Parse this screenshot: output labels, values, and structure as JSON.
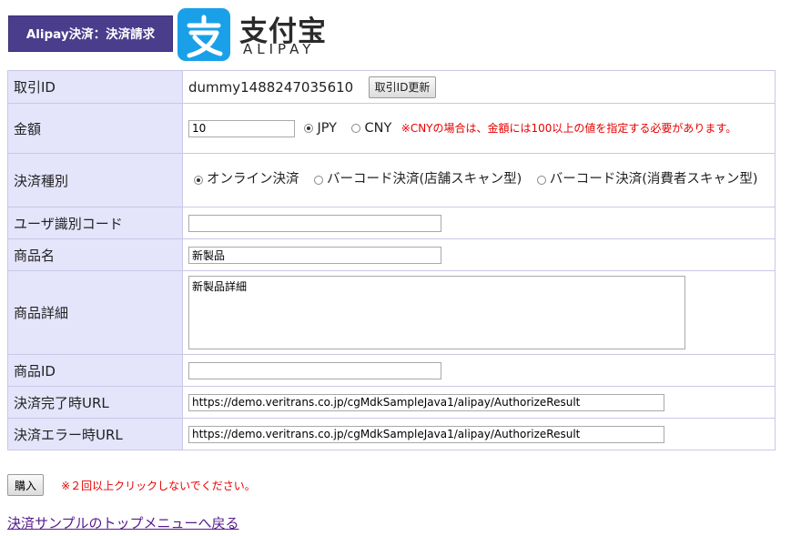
{
  "header": {
    "title": "Alipay決済：決済請求",
    "logo_cn": "支付宝",
    "logo_en": "ALIPAY"
  },
  "form": {
    "rows": [
      {
        "label": "取引ID"
      },
      {
        "label": "金額"
      },
      {
        "label": "決済種別"
      },
      {
        "label": "ユーザ識別コード"
      },
      {
        "label": "商品名"
      },
      {
        "label": "商品詳細"
      },
      {
        "label": "商品ID"
      },
      {
        "label": "決済完了時URL"
      },
      {
        "label": "決済エラー時URL"
      }
    ],
    "order_id": "dummy1488247035610",
    "order_id_refresh_label": "取引ID更新",
    "amount_value": "10",
    "currency_options": [
      "JPY",
      "CNY"
    ],
    "currency_selected": "JPY",
    "amount_warning": "※CNYの場合は、金額には100以上の値を指定する必要があります。",
    "payment_type_options": [
      "オンライン決済",
      "バーコード決済(店舗スキャン型)",
      "バーコード決済(消費者スキャン型)"
    ],
    "payment_type_selected": "オンライン決済",
    "user_code_value": "",
    "product_name_value": "新製品",
    "product_detail_value": "新製品詳細",
    "product_id_value": "",
    "success_url_value": "https://demo.veritrans.co.jp/cgMdkSampleJava1/alipay/AuthorizeResult",
    "error_url_value": "https://demo.veritrans.co.jp/cgMdkSampleJava1/alipay/AuthorizeResult"
  },
  "footer": {
    "submit_label": "購入",
    "submit_warning": "※２回以上クリックしないでください。",
    "back_link": "決済サンプルのトップメニューへ戻る"
  },
  "colors": {
    "title_bg": "#4a3d8c",
    "label_bg": "#e4e4fb",
    "warning": "#e60000",
    "alipay_blue": "#1aa0e8",
    "link": "#551a8b"
  }
}
